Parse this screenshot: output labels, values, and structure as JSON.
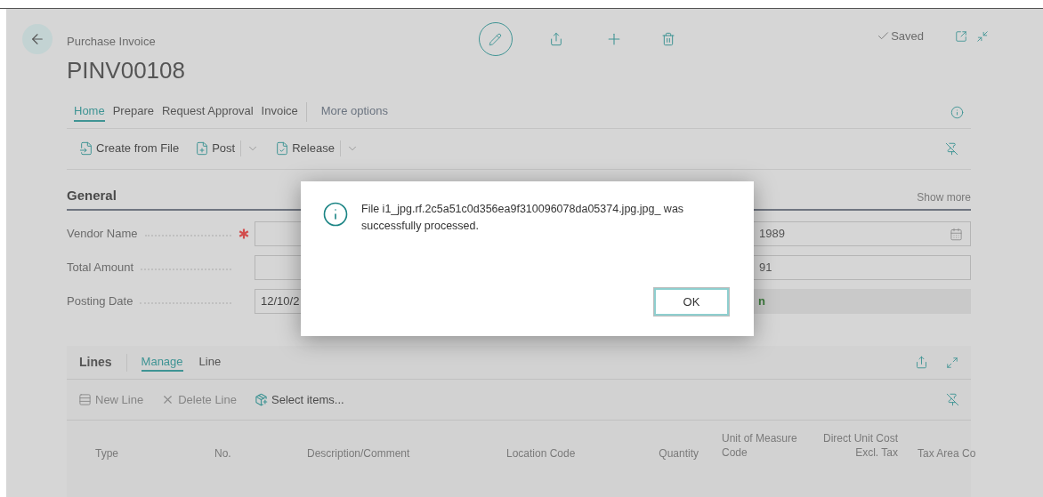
{
  "header": {
    "caption": "Purchase Invoice",
    "title": "PINV00108",
    "status": "Saved"
  },
  "tabs": [
    {
      "label": "Home",
      "selected": true,
      "kind": "tab"
    },
    {
      "label": "Prepare",
      "selected": false,
      "kind": "tab"
    },
    {
      "label": "Request Approval",
      "selected": false,
      "kind": "tab"
    },
    {
      "label": "Invoice",
      "selected": false,
      "kind": "tab"
    },
    {
      "label": "More options",
      "selected": false,
      "kind": "more"
    }
  ],
  "actions": [
    {
      "label": "Create from File",
      "kind": "action"
    },
    {
      "label": "Post",
      "kind": "split"
    },
    {
      "label": "Release",
      "kind": "split"
    }
  ],
  "general": {
    "title": "General",
    "show_more": "Show more",
    "fields": [
      {
        "label": "Vendor Name",
        "required": true
      },
      {
        "label": "Total Amount",
        "required": false
      },
      {
        "label": "Posting Date",
        "required": false,
        "value": "12/10/2"
      }
    ],
    "right_fields": [
      {
        "value": "1989",
        "kind": "date"
      },
      {
        "value": "91",
        "kind": "text"
      },
      {
        "value": "n",
        "kind": "status"
      }
    ]
  },
  "dialog": {
    "message": "File i1_jpg.rf.2c5a51c0d356ea9f310096078da05374.jpg.jpg_ was successfully processed.",
    "button": "OK"
  },
  "lines": {
    "title": "Lines",
    "tabs": [
      {
        "label": "Manage",
        "selected": true
      },
      {
        "label": "Line",
        "selected": false
      }
    ],
    "actions": [
      {
        "label": "New Line",
        "disabled": true,
        "kind": "new"
      },
      {
        "label": "Delete Line",
        "disabled": true,
        "kind": "delete"
      },
      {
        "label": "Select items...",
        "disabled": false,
        "kind": "select"
      }
    ],
    "columns": [
      "Type",
      "No.",
      "Description/Comment",
      "Location Code",
      "Quantity",
      "Unit of Measure Code",
      "Direct Unit Cost Excl. Tax",
      "Tax Area Co"
    ]
  }
}
